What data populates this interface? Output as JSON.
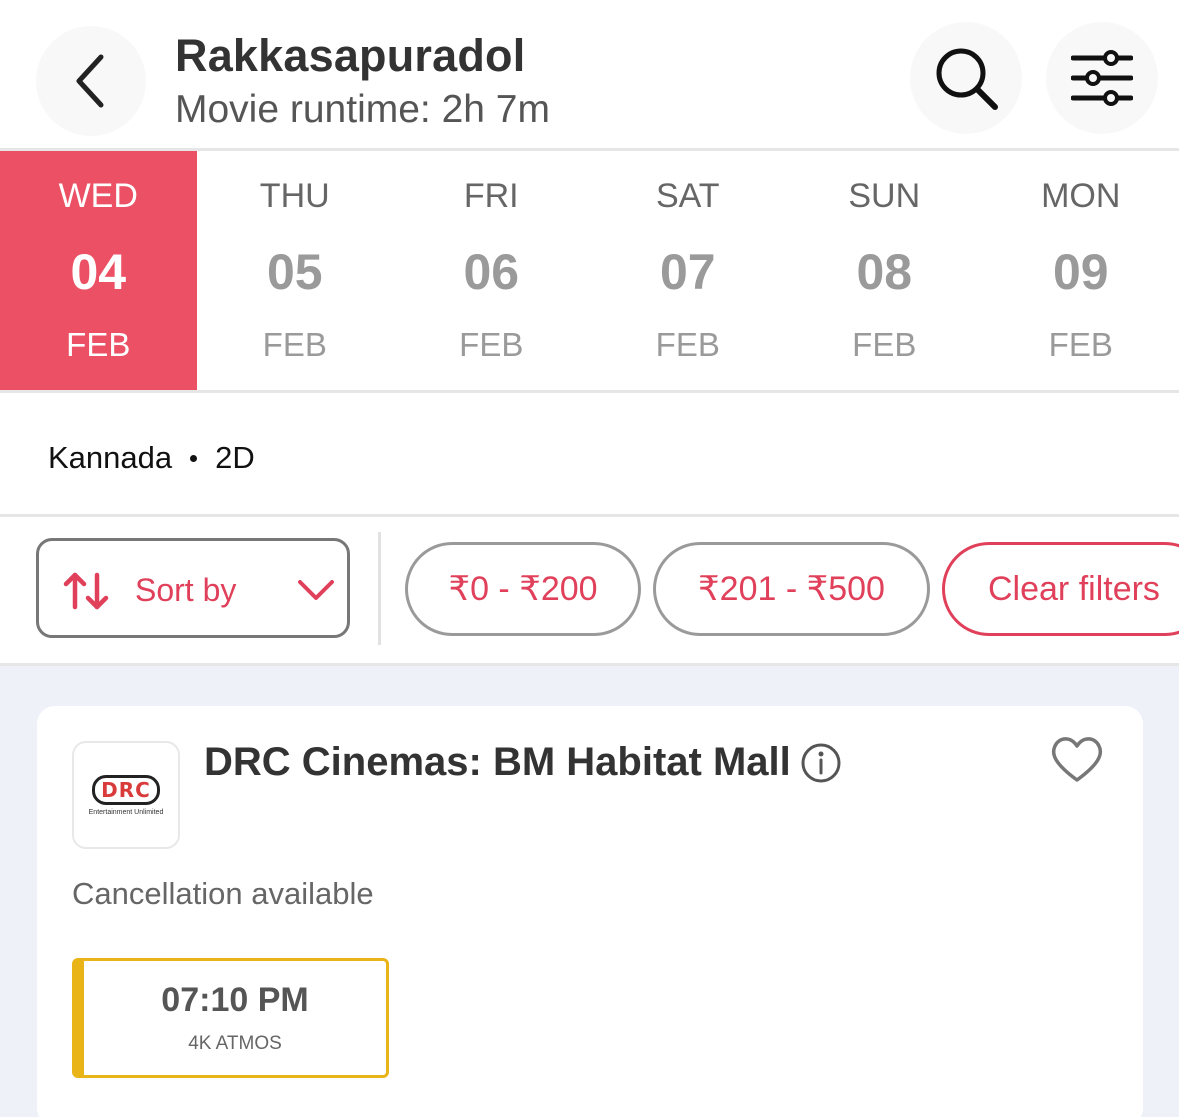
{
  "header": {
    "title": "Rakkasapuradol",
    "subtitle": "Movie runtime: 2h 7m"
  },
  "dates": [
    {
      "dow": "WED",
      "day": "04",
      "month": "FEB",
      "selected": true
    },
    {
      "dow": "THU",
      "day": "05",
      "month": "FEB",
      "selected": false
    },
    {
      "dow": "FRI",
      "day": "06",
      "month": "FEB",
      "selected": false
    },
    {
      "dow": "SAT",
      "day": "07",
      "month": "FEB",
      "selected": false
    },
    {
      "dow": "SUN",
      "day": "08",
      "month": "FEB",
      "selected": false
    },
    {
      "dow": "MON",
      "day": "09",
      "month": "FEB",
      "selected": false
    }
  ],
  "language": {
    "name": "Kannada",
    "format": "2D"
  },
  "filters": {
    "sort_label": "Sort by",
    "chips": [
      "₹0 - ₹200",
      "₹201 - ₹500",
      "Clear filters"
    ]
  },
  "cinema": {
    "logo_text": "DRC",
    "logo_tagline": "Entertainment Unlimited",
    "name": "DRC Cinemas: BM Habitat Mall",
    "cancellation": "Cancellation available",
    "showtimes": [
      {
        "time": "07:10 PM",
        "format": "4K ATMOS"
      }
    ]
  },
  "colors": {
    "accent": "#ec5064",
    "accent_text": "#e0405a",
    "showtime_border": "#e8b418",
    "content_bg": "#eef2f8"
  }
}
